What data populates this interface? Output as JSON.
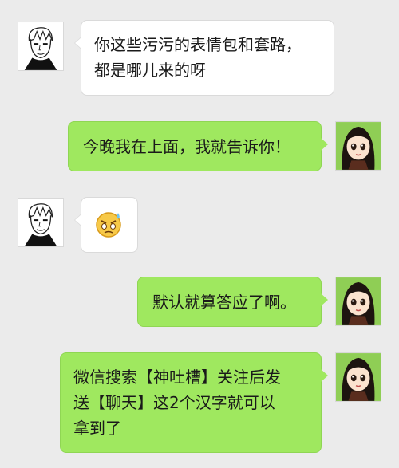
{
  "chat": {
    "messages": [
      {
        "sender": "contact",
        "avatar_icon": "sketch-boy-avatar-icon",
        "text": "你这些污污的表情包和套路，\n都是哪儿来的呀"
      },
      {
        "sender": "me",
        "avatar_icon": "cartoon-girl-avatar-icon",
        "text": "今晚我在上面，我就告诉你！"
      },
      {
        "sender": "contact",
        "avatar_icon": "sketch-boy-avatar-icon",
        "sticker_icon": "sweating-emoji-sticker-icon"
      },
      {
        "sender": "me",
        "avatar_icon": "cartoon-girl-avatar-icon",
        "text": "默认就算答应了啊。"
      },
      {
        "sender": "me",
        "avatar_icon": "cartoon-girl-avatar-icon",
        "text": "微信搜索【神吐槽】关注后发\n送【聊天】这2个汉字就可以\n拿到了"
      }
    ]
  },
  "colors": {
    "background": "#ebebeb",
    "incoming_bubble": "#ffffff",
    "outgoing_bubble": "#9fe85f",
    "text": "#1a1a1a"
  }
}
